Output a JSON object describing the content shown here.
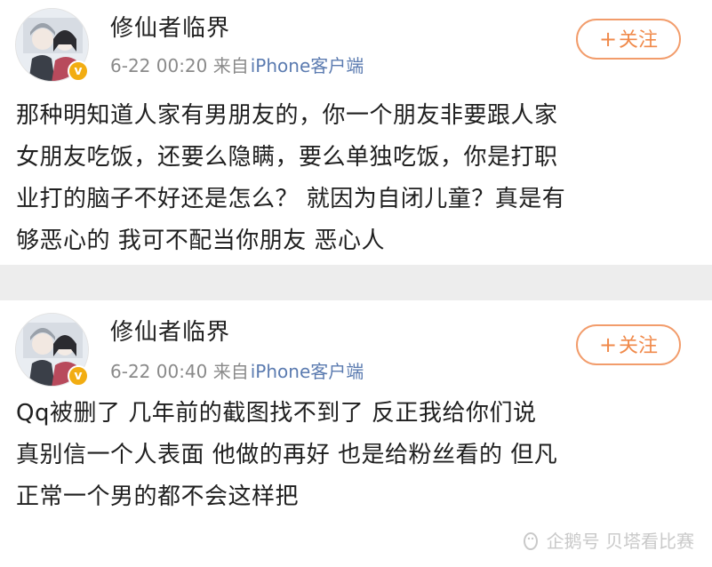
{
  "posts": [
    {
      "username": "修仙者临界",
      "time": "6-22 00:20",
      "source_prefix": "来自",
      "client": "iPhone客户端",
      "follow_label": "关注",
      "follow_plus": "+",
      "verified_badge": "v",
      "lines": [
        "那种明知道人家有男朋友的，你一个朋友非要跟人家",
        "女朋友吃饭，还要么隐瞒，要么单独吃饭，你是打职",
        "业打的脑子不好还是怎么？  就因为自闭儿童？真是有",
        "够恶心的  我可不配当你朋友   恶心人"
      ]
    },
    {
      "username": "修仙者临界",
      "time": "6-22 00:40",
      "source_prefix": "来自",
      "client": "iPhone客户端",
      "follow_label": "关注",
      "follow_plus": "+",
      "verified_badge": "v",
      "lines": [
        "Qq被删了  几年前的截图找不到了  反正我给你们说",
        "真别信一个人表面  他做的再好  也是给粉丝看的  但凡",
        "正常一个男的都不会这样把"
      ]
    }
  ],
  "watermark": {
    "text": "企鹅号 贝塔看比赛",
    "icon": "penguin-logo-icon"
  },
  "colors": {
    "follow_accent": "#f08a4b",
    "client_link": "#5b7bb0",
    "verify_badge": "#f2ad12",
    "separator": "#ededed"
  }
}
